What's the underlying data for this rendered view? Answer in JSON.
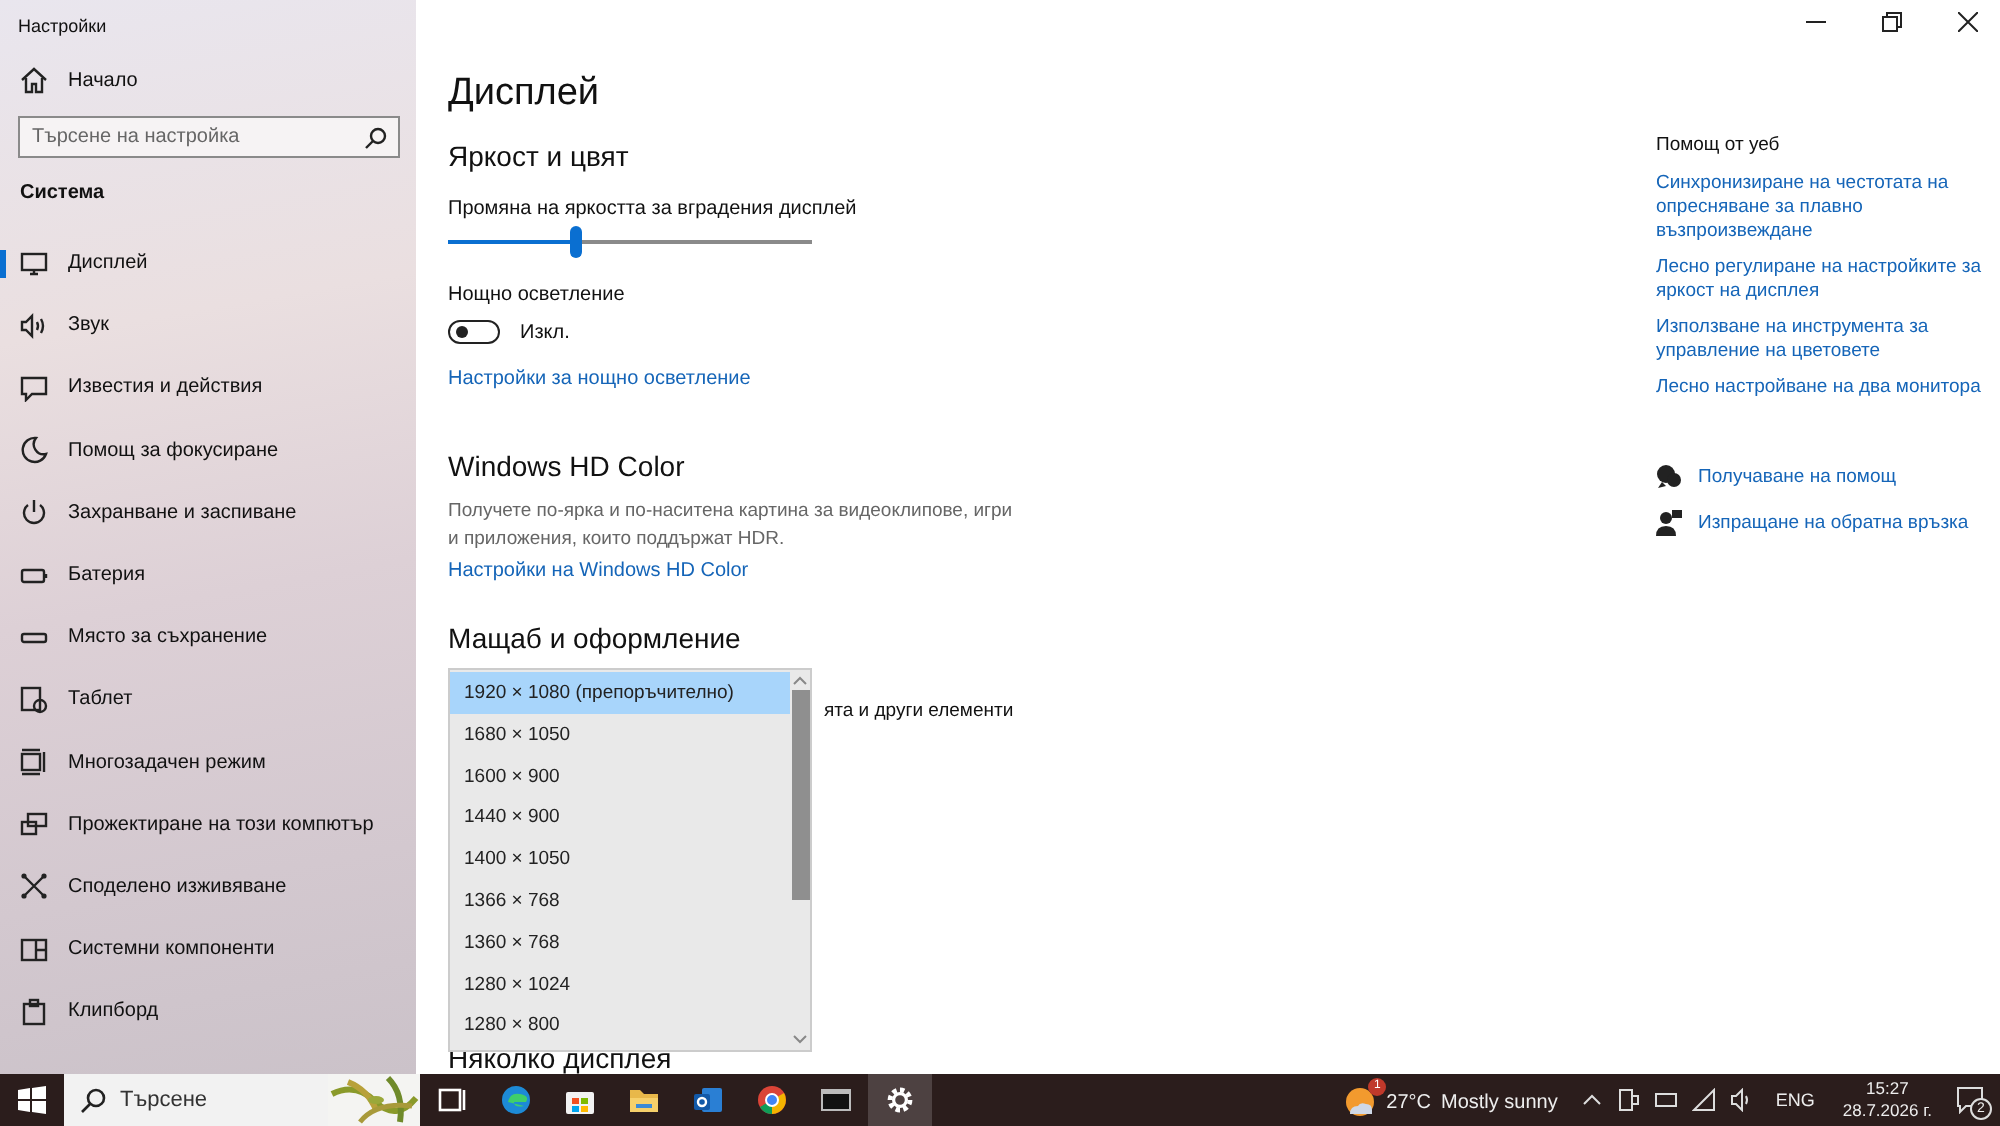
{
  "window": {
    "title": "Настройки"
  },
  "sidebar": {
    "home": "Начало",
    "search": {
      "placeholder": "Търсене на настройка"
    },
    "section": "Система",
    "items": [
      {
        "label": "Дисплей",
        "selected": true
      },
      {
        "label": "Звук",
        "selected": false
      },
      {
        "label": "Известия и действия",
        "selected": false
      },
      {
        "label": "Помощ за фокусиране",
        "selected": false
      },
      {
        "label": "Захранване и заспиване",
        "selected": false
      },
      {
        "label": "Батерия",
        "selected": false
      },
      {
        "label": "Място за съхранение",
        "selected": false
      },
      {
        "label": "Таблет",
        "selected": false
      },
      {
        "label": "Многозадачен режим",
        "selected": false
      },
      {
        "label": "Прожектиране на този компютър",
        "selected": false
      },
      {
        "label": "Споделено изживяване",
        "selected": false
      },
      {
        "label": "Системни компоненти",
        "selected": false
      },
      {
        "label": "Клипборд",
        "selected": false
      }
    ]
  },
  "page": {
    "title": "Дисплей",
    "brightness": {
      "heading": "Яркост и цвят",
      "label": "Промяна на яркостта за вградения дисплей",
      "level": 0.35
    },
    "night_light": {
      "label": "Нощно осветление",
      "on": false,
      "state_text": "Изкл.",
      "link": "Настройки за нощно осветление"
    },
    "hd_color": {
      "heading": "Windows HD Color",
      "description": "Получете по-ярка и по-наситена картина за видеоклипове, игри и приложения, които поддържат HDR.",
      "link": "Настройки на Windows HD Color"
    },
    "scale": {
      "heading": "Мащаб и оформление",
      "partial_text": "ята и други елементи"
    },
    "resolution_list": [
      {
        "label": "1920 × 1080 (препоръчително)",
        "selected": true
      },
      {
        "label": "1680 × 1050",
        "selected": false
      },
      {
        "label": "1600 × 900",
        "selected": false
      },
      {
        "label": "1440 × 900",
        "selected": false
      },
      {
        "label": "1400 × 1050",
        "selected": false
      },
      {
        "label": "1366 × 768",
        "selected": false
      },
      {
        "label": "1360 × 768",
        "selected": false
      },
      {
        "label": "1280 × 1024",
        "selected": false
      },
      {
        "label": "1280 × 800",
        "selected": false
      }
    ],
    "multiple_displays": {
      "heading": "Няколко дисплея"
    }
  },
  "help": {
    "heading": "Помощ от уеб",
    "links": [
      "Синхронизиране на честотата на опресняване за плавно възпроизвеждане",
      "Лесно регулиране на настройките за яркост на дисплея",
      "Използване на инструмента за управление на цветовете",
      "Лесно настройване на два монитора"
    ],
    "actions": [
      {
        "kind": "help",
        "label": "Получаване на помощ"
      },
      {
        "kind": "feedback",
        "label": "Изпращане на обратна връзка"
      }
    ]
  },
  "taskbar": {
    "search": {
      "placeholder": "Търсене"
    },
    "apps": [
      {
        "kind": "taskview",
        "active": false
      },
      {
        "kind": "edge",
        "active": false
      },
      {
        "kind": "store",
        "active": false
      },
      {
        "kind": "explorer",
        "active": false
      },
      {
        "kind": "outlook",
        "active": false
      },
      {
        "kind": "chrome",
        "active": false
      },
      {
        "kind": "terminal",
        "active": false
      },
      {
        "kind": "settings",
        "active": true
      }
    ],
    "weather": {
      "badge": "1",
      "temperature": "27°C",
      "condition": "Mostly sunny"
    },
    "language": "ENG",
    "time": "15:27",
    "date": "28.7.2026 г.",
    "notifications": "2"
  }
}
